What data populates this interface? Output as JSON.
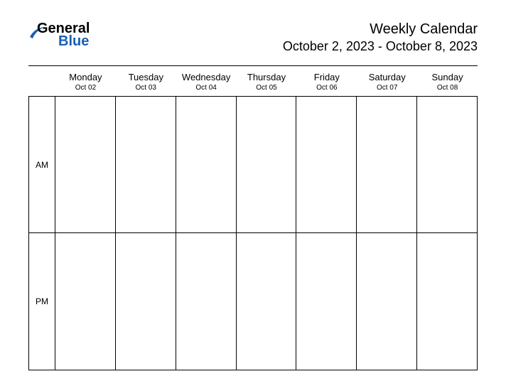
{
  "logo": {
    "word1": "General",
    "word2": "Blue"
  },
  "header": {
    "title": "Weekly Calendar",
    "dateRange": "October 2, 2023 - October 8, 2023"
  },
  "days": [
    {
      "name": "Monday",
      "date": "Oct 02"
    },
    {
      "name": "Tuesday",
      "date": "Oct 03"
    },
    {
      "name": "Wednesday",
      "date": "Oct 04"
    },
    {
      "name": "Thursday",
      "date": "Oct 05"
    },
    {
      "name": "Friday",
      "date": "Oct 06"
    },
    {
      "name": "Saturday",
      "date": "Oct 07"
    },
    {
      "name": "Sunday",
      "date": "Oct 08"
    }
  ],
  "periods": {
    "am": "AM",
    "pm": "PM"
  }
}
